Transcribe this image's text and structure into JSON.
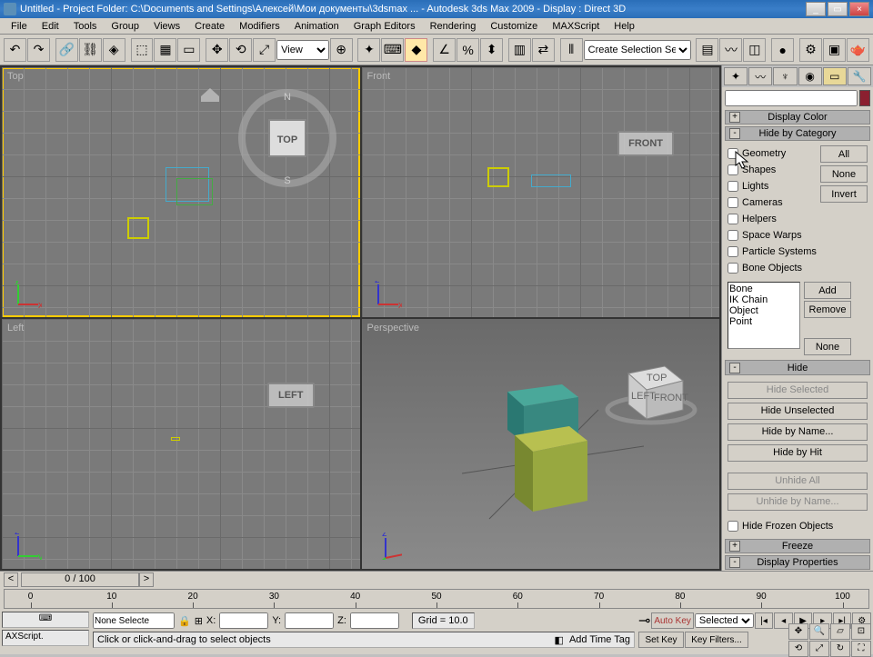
{
  "title": "Untitled   - Project Folder: C:\\Documents and Settings\\Алексей\\Мои документы\\3dsmax ...   - Autodesk 3ds Max  2009   - Display : Direct 3D",
  "menu": [
    "File",
    "Edit",
    "Tools",
    "Group",
    "Views",
    "Create",
    "Modifiers",
    "Animation",
    "Graph Editors",
    "Rendering",
    "Customize",
    "MAXScript",
    "Help"
  ],
  "toolbar": {
    "view_dropdown": "View",
    "selection_set": "Create Selection Set"
  },
  "viewports": {
    "top": "Top",
    "front": "Front",
    "left": "Left",
    "perspective": "Perspective",
    "cube_top": "TOP",
    "cube_front": "FRONT",
    "cube_left": "LEFT"
  },
  "panel": {
    "rollup_display_color": "Display Color",
    "rollup_hide_category": "Hide by Category",
    "categories": [
      "Geometry",
      "Shapes",
      "Lights",
      "Cameras",
      "Helpers",
      "Space Warps",
      "Particle Systems",
      "Bone Objects"
    ],
    "btn_all": "All",
    "btn_none": "None",
    "btn_invert": "Invert",
    "list_items": [
      "Bone",
      "IK Chain Object",
      "Point"
    ],
    "btn_add": "Add",
    "btn_remove": "Remove",
    "btn_none2": "None",
    "rollup_hide": "Hide",
    "btn_hide_selected": "Hide Selected",
    "btn_hide_unselected": "Hide Unselected",
    "btn_hide_by_name": "Hide by Name...",
    "btn_hide_by_hit": "Hide by Hit",
    "btn_unhide_all": "Unhide All",
    "btn_unhide_by_name": "Unhide by Name...",
    "chk_hide_frozen": "Hide Frozen Objects",
    "rollup_freeze": "Freeze",
    "rollup_display_props": "Display Properties"
  },
  "timeline": {
    "slider_label": "0 / 100",
    "ticks": [
      0,
      10,
      20,
      30,
      40,
      50,
      60,
      70,
      80,
      90,
      100
    ]
  },
  "status": {
    "script_box": "AXScript.",
    "selection_box": "None Selecte",
    "coord_x": "X:",
    "coord_y": "Y:",
    "coord_z": "Z:",
    "grid": "Grid = 10.0",
    "prompt": "Click or click-and-drag to select objects",
    "add_time_tag": "Add Time Tag",
    "auto_key": "Auto Key",
    "set_key": "Set Key",
    "selected": "Selected",
    "key_filters": "Key Filters..."
  }
}
